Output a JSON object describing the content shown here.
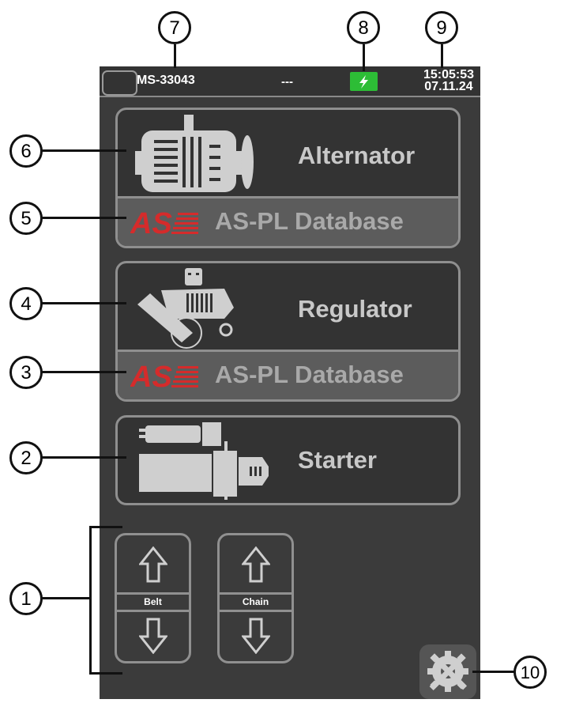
{
  "status": {
    "device": "MS-33043",
    "middle": "---",
    "time": "15:05:53",
    "date": "07.11.24"
  },
  "cards": {
    "alternator": {
      "label": "Alternator",
      "db": "AS-PL Database"
    },
    "regulator": {
      "label": "Regulator",
      "db": "AS-PL Database"
    },
    "starter": {
      "label": "Starter"
    }
  },
  "controls": {
    "belt": "Belt",
    "chain": "Chain"
  },
  "callouts": [
    "1",
    "2",
    "3",
    "4",
    "5",
    "6",
    "7",
    "8",
    "9",
    "10"
  ],
  "colors": {
    "background": "#3b3b3b",
    "battery": "#2dbd36",
    "brand_red": "#d52b2b"
  },
  "icons": [
    "connector-icon",
    "battery-charging-icon",
    "alternator-icon",
    "regulator-icon",
    "starter-icon",
    "as-logo-icon",
    "arrow-up-icon",
    "arrow-down-icon",
    "settings-tools-icon"
  ]
}
